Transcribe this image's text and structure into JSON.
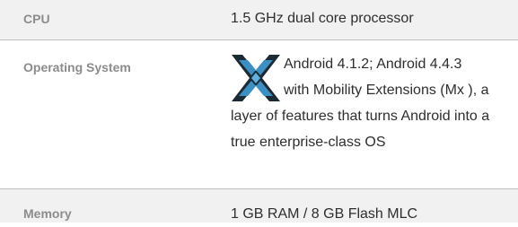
{
  "specs": [
    {
      "label": "CPU",
      "value": "1.5 GHz dual core processor"
    },
    {
      "label": "Operating System",
      "value": "Android 4.1.2; Android 4.4.3 with Mobility Extensions (Mx ), a layer of features that turns Android into a true enterprise-class OS",
      "icon": "mx-extensions-logo-icon"
    },
    {
      "label": "Memory",
      "value": "1 GB RAM / 8 GB Flash MLC"
    }
  ],
  "colors": {
    "row_alt_background": "#f1f1f1",
    "label_text": "#8c8c8c",
    "value_text": "#2e2e2e",
    "divider": "#bdbdbd",
    "logo_dark": "#1b2a33",
    "logo_blue": "#3c8fc3"
  }
}
